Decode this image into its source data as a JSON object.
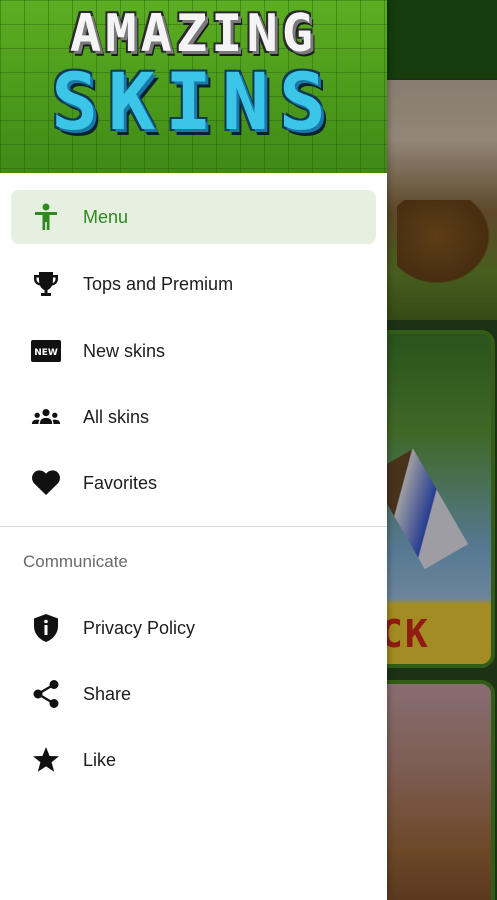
{
  "drawer": {
    "logo": {
      "line1": "AMAZING",
      "line2": "SKINS"
    },
    "items": [
      {
        "label": "Menu",
        "icon": "person-icon",
        "active": true
      },
      {
        "label": "Tops and Premium",
        "icon": "trophy-icon",
        "active": false
      },
      {
        "label": "New skins",
        "icon": "new-badge-icon",
        "active": false
      },
      {
        "label": "All skins",
        "icon": "group-icon",
        "active": false
      },
      {
        "label": "Favorites",
        "icon": "heart-icon",
        "active": false
      }
    ],
    "section_title": "Communicate",
    "communicate_items": [
      {
        "label": "Privacy Policy",
        "icon": "shield-info-icon"
      },
      {
        "label": "Share",
        "icon": "share-icon"
      },
      {
        "label": "Like",
        "icon": "star-icon"
      }
    ],
    "new_badge_text": "NEW"
  },
  "background": {
    "card_label": "CK"
  },
  "colors": {
    "accent": "#2e8a1e",
    "active_bg": "#e6f0e0",
    "header_green": "#4a9a1e",
    "logo_blue": "#3bc6e8"
  }
}
